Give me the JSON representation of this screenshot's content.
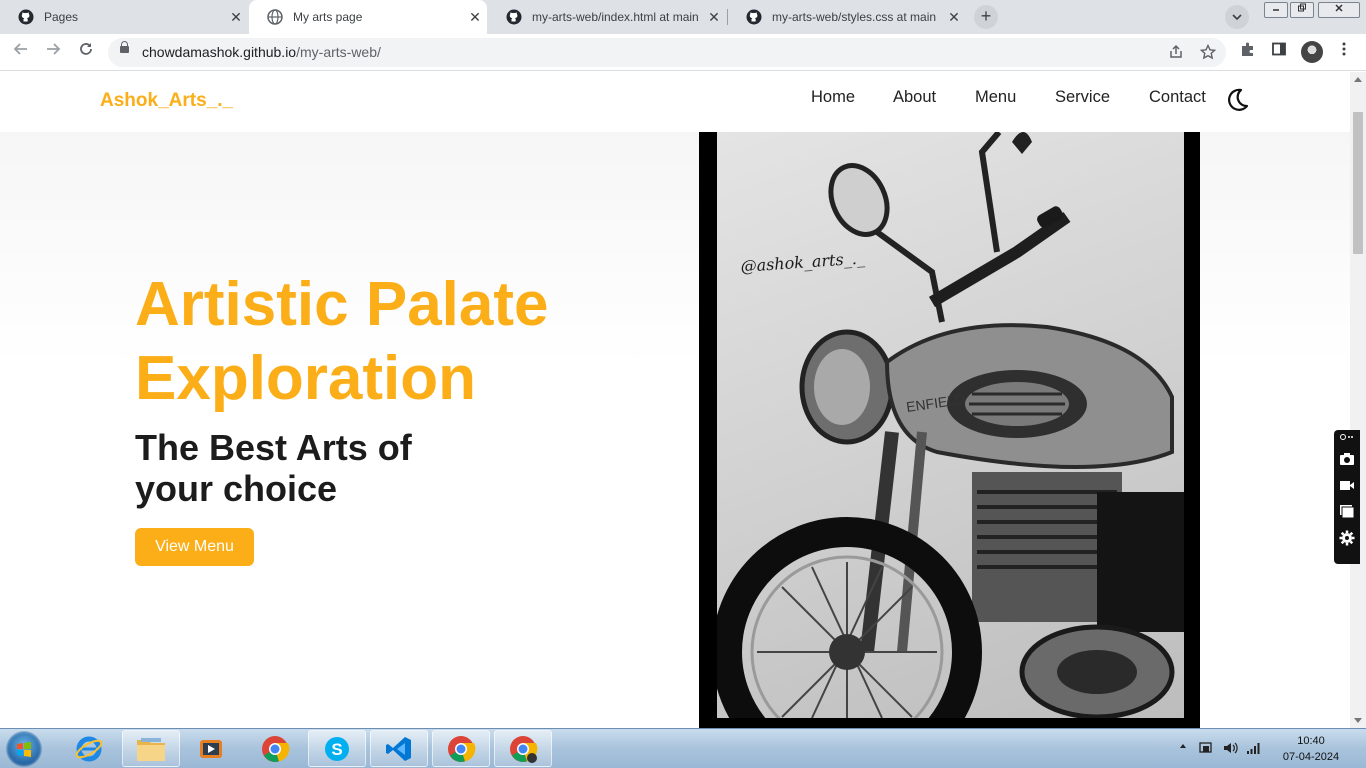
{
  "browser": {
    "tabs": [
      {
        "title": "Pages",
        "icon": "github-icon",
        "active": false
      },
      {
        "title": "My arts page",
        "icon": "globe-icon",
        "active": true
      },
      {
        "title": "my-arts-web/index.html at main",
        "icon": "github-icon",
        "active": false
      },
      {
        "title": "my-arts-web/styles.css at main",
        "icon": "github-icon",
        "active": false
      }
    ],
    "new_tab_symbol": "+",
    "close_symbol": "✕",
    "address": {
      "host": "chowdamashok.github.io",
      "path": "/my-arts-web/"
    }
  },
  "site": {
    "brand": "Ashok_Arts_._",
    "nav": [
      "Home",
      "About",
      "Menu",
      "Service",
      "Contact"
    ],
    "hero_title_line1": "Artistic Palate",
    "hero_title_line2": "Exploration",
    "hero_sub_line1": "The Best Arts of",
    "hero_sub_line2": "your choice",
    "cta_label": "View Menu",
    "artwork_signature": "@ashok_arts_._",
    "accent_color": "#fbae17"
  },
  "taskbar": {
    "apps": [
      "internet-explorer",
      "file-explorer",
      "media-player",
      "chrome",
      "skype",
      "vs-code",
      "chrome",
      "chrome"
    ],
    "time": "10:40",
    "date": "07-04-2024"
  }
}
